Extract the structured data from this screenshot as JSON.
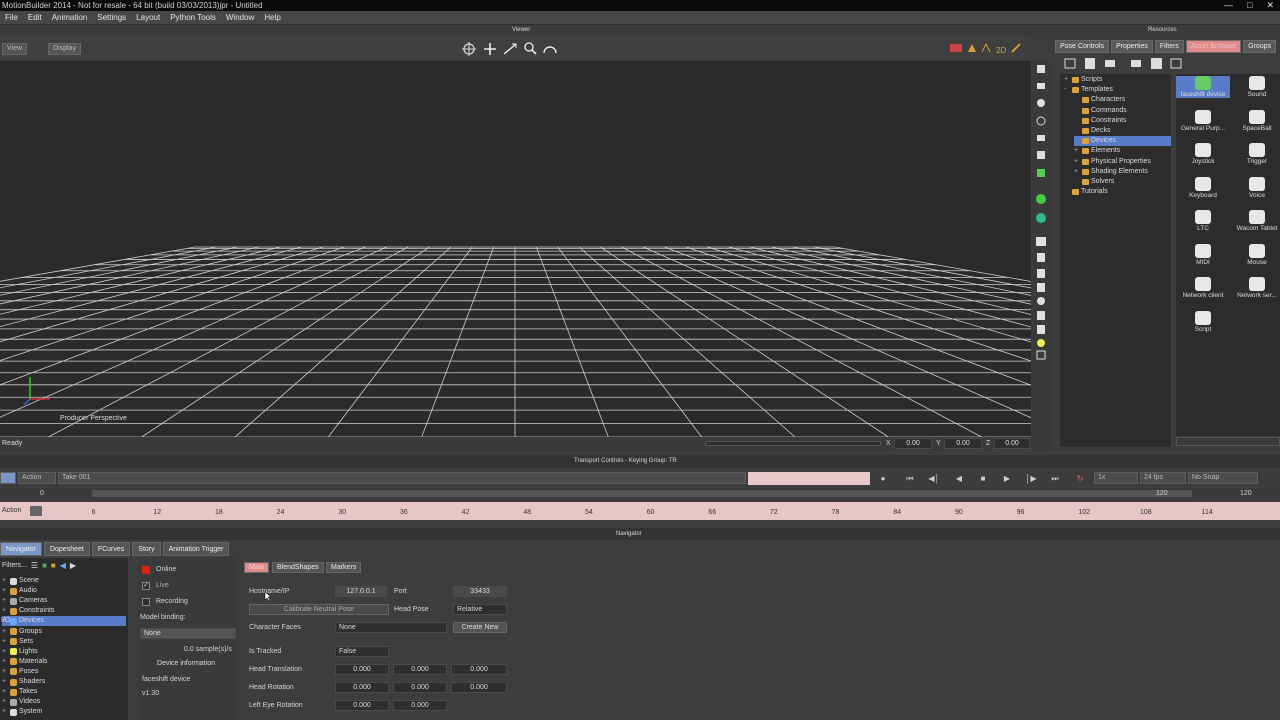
{
  "app": {
    "title": "MotionBuilder 2014 - Not for resale - 64 bit (build 03/03/2013)jpr - Untitled"
  },
  "menu": [
    "File",
    "Edit",
    "Animation",
    "Settings",
    "Layout",
    "Python Tools",
    "Window",
    "Help"
  ],
  "viewer": {
    "caption": "Viewer",
    "view_button": "View",
    "display_button": "Display",
    "camera_label": "Producer Perspective",
    "status": "Ready"
  },
  "xyz": {
    "x": "0.00",
    "y": "0.00",
    "z": "0.00",
    "xl": "X",
    "yl": "Y",
    "zl": "Z"
  },
  "resources": {
    "caption": "Resources",
    "tabs": [
      "Pose Controls",
      "Properties",
      "Filters",
      "Asset Browser",
      "Groups"
    ],
    "tree": [
      {
        "label": "Scripts",
        "depth": 1,
        "pm": "+"
      },
      {
        "label": "Templates",
        "depth": 1,
        "pm": "-"
      },
      {
        "label": "Characters",
        "depth": 2,
        "pm": ""
      },
      {
        "label": "Commands",
        "depth": 2,
        "pm": ""
      },
      {
        "label": "Constraints",
        "depth": 2,
        "pm": ""
      },
      {
        "label": "Decks",
        "depth": 2,
        "pm": ""
      },
      {
        "label": "Devices",
        "depth": 2,
        "pm": "",
        "selected": true
      },
      {
        "label": "Elements",
        "depth": 2,
        "pm": "+"
      },
      {
        "label": "Physical Properties",
        "depth": 2,
        "pm": "+"
      },
      {
        "label": "Shading Elements",
        "depth": 2,
        "pm": "+"
      },
      {
        "label": "Solvers",
        "depth": 2,
        "pm": ""
      },
      {
        "label": "Tutorials",
        "depth": 1,
        "pm": ""
      }
    ],
    "assets": [
      {
        "label": "faceshift device",
        "icon": "faceshift-device-icon"
      },
      {
        "label": "Sound",
        "icon": "sound-icon"
      },
      {
        "label": "General Purp...",
        "icon": "general-purpose-icon"
      },
      {
        "label": "SpaceBall",
        "icon": "spaceball-icon"
      },
      {
        "label": "Joystick",
        "icon": "joystick-icon"
      },
      {
        "label": "Trigger",
        "icon": "trigger-icon"
      },
      {
        "label": "Keyboard",
        "icon": "keyboard-icon"
      },
      {
        "label": "Voice",
        "icon": "voice-icon"
      },
      {
        "label": "LTC",
        "icon": "ltc-icon"
      },
      {
        "label": "Wacom Tablet",
        "icon": "wacom-icon"
      },
      {
        "label": "MIDI",
        "icon": "midi-icon"
      },
      {
        "label": "Mouse",
        "icon": "mouse-icon"
      },
      {
        "label": "Network client",
        "icon": "network-client-icon"
      },
      {
        "label": "Network ser...",
        "icon": "network-server-icon"
      },
      {
        "label": "Script",
        "icon": "script-icon"
      }
    ]
  },
  "transport": {
    "caption": "Transport Controls - Keying Group: TR",
    "mode": "Action",
    "take": "Take 001",
    "speed": "1x",
    "fps": "24 fps",
    "snap": "No Snap",
    "start": "0",
    "start2": "0",
    "end": "120",
    "end2": "120",
    "action_label": "Action",
    "ticks": [
      "6",
      "12",
      "18",
      "24",
      "30",
      "36",
      "42",
      "48",
      "54",
      "60",
      "66",
      "72",
      "78",
      "84",
      "90",
      "96",
      "102",
      "108",
      "114"
    ]
  },
  "navigator": {
    "caption": "Navigator",
    "tabs": [
      "Navigator",
      "Dopesheet",
      "FCurves",
      "Story",
      "Animation Trigger"
    ],
    "filters": "Filters...",
    "tree": [
      "Scene",
      "Audio",
      "Cameras",
      "Constraints",
      "Devices",
      "Groups",
      "Sets",
      "Lights",
      "Materials",
      "Poses",
      "Shaders",
      "Takes",
      "Videos",
      "System"
    ],
    "io_label": "I/O"
  },
  "device": {
    "online": "Online",
    "live": "Live",
    "recording": "Recording",
    "model_binding_label": "Model binding:",
    "model_binding": "None",
    "rate": "0.0 sample(s)/s",
    "info_button": "Device information",
    "name": "faceshift device",
    "version": "v1.30"
  },
  "props": {
    "tabs": [
      "Main",
      "BlendShapes",
      "Markers"
    ],
    "hostname_label": "Hostname/IP",
    "hostname": "127.0.0.1",
    "port_label": "Port",
    "port": "33433",
    "calibrate": "Calibrate Neutral Pose",
    "headpose_label": "Head Pose",
    "headpose": "Relative",
    "charfaces_label": "Character Faces",
    "charfaces": "None",
    "create_new": "Create New",
    "istracked_label": "Is Tracked",
    "istracked": "False",
    "head_translation_label": "Head Translation",
    "head_translation": [
      "0.000",
      "0.000",
      "0.000"
    ],
    "head_rotation_label": "Head Rotation",
    "head_rotation": [
      "0.000",
      "0.000",
      "0.000"
    ],
    "left_eye_label": "Left Eye Rotation",
    "left_eye": [
      "0.000",
      "0.000"
    ]
  },
  "colors": {
    "accent": "#e08a8a",
    "selection": "#5a7cc8",
    "timeline": "#e6c6c6"
  }
}
